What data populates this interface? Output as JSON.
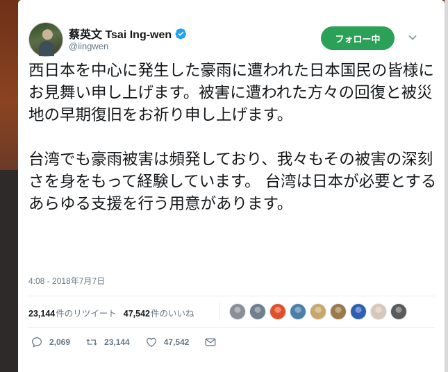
{
  "tweet": {
    "author": {
      "name": "蔡英文 Tsai Ing-wen",
      "handle": "@iingwen",
      "verified_icon": "verified-badge-icon"
    },
    "follow_button_label": "フォロー中",
    "paragraph1": "西日本を中心に発生した豪雨に遭われた日本国民の皆様にお見舞い申し上げます。被害に遭われた方々の回復と被災地の早期復旧をお祈り申し上げます。",
    "paragraph2": "台湾でも豪雨被害は頻発しており、我々もその被害の深刻さを身をもって経験しています。 台湾は日本が必要とするあらゆる支援を行う用意があります。",
    "timestamp": "4:08 - 2018年7月7日",
    "stats": {
      "retweets_count": "23,144",
      "retweets_label": "件のリツイート",
      "likes_count": "47,542",
      "likes_label": "件のいいね"
    },
    "likers_colors": [
      "#8a8f95",
      "#6f7f8c",
      "#e0502a",
      "#4a7fa8",
      "#c7a86a",
      "#9a7a4a",
      "#2f5fb5",
      "#d9c7b8",
      "#5a5a5a"
    ],
    "actions": {
      "reply_count": "2,069",
      "retweet_count": "23,144",
      "like_count": "47,542"
    },
    "colors": {
      "follow_green": "#2aa157",
      "verified_blue": "#1da1f2",
      "secondary_text": "#657786"
    }
  }
}
